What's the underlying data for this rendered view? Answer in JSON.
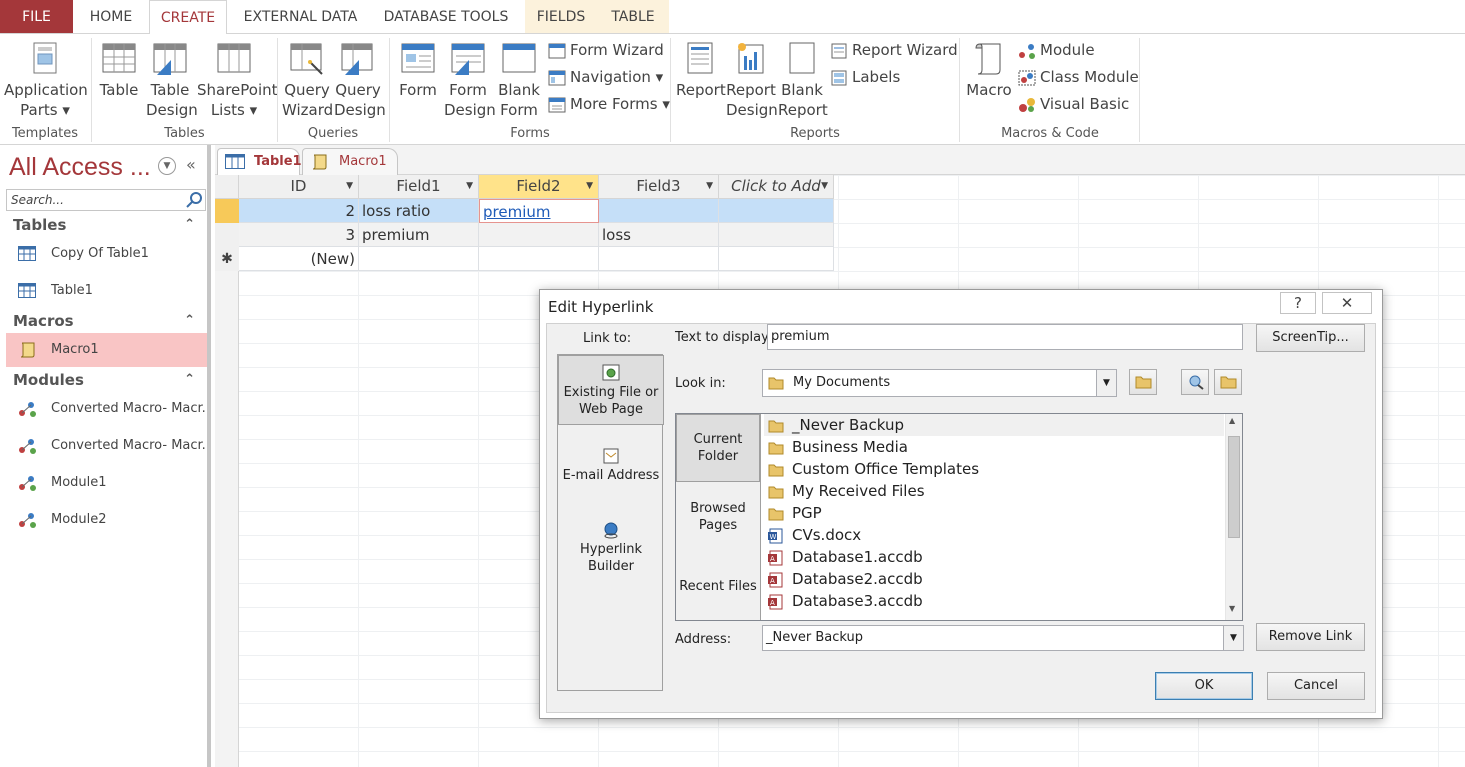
{
  "ribbon_tabs": [
    "FILE",
    "HOME",
    "CREATE",
    "EXTERNAL DATA",
    "DATABASE TOOLS",
    "FIELDS",
    "TABLE"
  ],
  "ribbon": {
    "templates": {
      "group": "Templates",
      "app_parts_1": "Application",
      "app_parts_2": "Parts ▾"
    },
    "tables": {
      "group": "Tables",
      "table": "Table",
      "table_design_1": "Table",
      "table_design_2": "Design",
      "sharepoint_1": "SharePoint",
      "sharepoint_2": "Lists ▾"
    },
    "queries": {
      "group": "Queries",
      "query_wizard_1": "Query",
      "query_wizard_2": "Wizard",
      "query_design_1": "Query",
      "query_design_2": "Design"
    },
    "forms": {
      "group": "Forms",
      "form": "Form",
      "form_design_1": "Form",
      "form_design_2": "Design",
      "blank_form_1": "Blank",
      "blank_form_2": "Form",
      "form_wizard": "Form Wizard",
      "navigation": "Navigation ▾",
      "more_forms": "More Forms ▾"
    },
    "reports": {
      "group": "Reports",
      "report": "Report",
      "report_design_1": "Report",
      "report_design_2": "Design",
      "blank_report_1": "Blank",
      "blank_report_2": "Report",
      "report_wizard": "Report Wizard",
      "labels": "Labels"
    },
    "macros": {
      "group": "Macros & Code",
      "macro": "Macro",
      "module": "Module",
      "class_module": "Class Module",
      "visual_basic": "Visual Basic"
    }
  },
  "nav": {
    "title": "All Access ...",
    "search_placeholder": "Search...",
    "sections": [
      {
        "label": "Tables",
        "items": [
          "Copy Of Table1",
          "Table1"
        ]
      },
      {
        "label": "Macros",
        "items": [
          "Macro1"
        ]
      },
      {
        "label": "Modules",
        "items": [
          "Converted Macro- Macr...",
          "Converted Macro- Macr...",
          "Module1",
          "Module2"
        ]
      }
    ]
  },
  "doc_tabs": [
    "Table1",
    "Macro1"
  ],
  "datasheet": {
    "columns": [
      "ID",
      "Field1",
      "Field2",
      "Field3",
      "Click to Add"
    ],
    "rows": [
      {
        "id": "2",
        "field1": "loss ratio",
        "field2": "premium",
        "field3": ""
      },
      {
        "id": "3",
        "field1": "premium",
        "field2": "",
        "field3": "loss"
      }
    ],
    "new_row": "(New)"
  },
  "dialog": {
    "title": "Edit Hyperlink",
    "help_icon": "?",
    "close_icon": "✕",
    "link_to_label": "Link to:",
    "link_to": [
      "Existing File or Web Page",
      "E-mail Address",
      "Hyperlink Builder"
    ],
    "text_to_display_label": "Text to display:",
    "text_to_display": "premium",
    "screentip": "ScreenTip...",
    "look_in_label": "Look in:",
    "look_in": "My Documents",
    "browse_tabs": [
      "Current Folder",
      "Browsed Pages",
      "Recent Files"
    ],
    "files": [
      "_Never Backup",
      "Business Media",
      "Custom Office Templates",
      "My Received Files",
      "PGP",
      "CVs.docx",
      "Database1.accdb",
      "Database2.accdb",
      "Database3.accdb"
    ],
    "address_label": "Address:",
    "address": "_Never Backup",
    "remove_link": "Remove Link",
    "ok": "OK",
    "cancel": "Cancel"
  },
  "colors": {
    "brand": "#a4373a",
    "selected_row": "#c5dff8",
    "selected_nav": "#f9c5c5",
    "field_header": "#ffe38a"
  }
}
